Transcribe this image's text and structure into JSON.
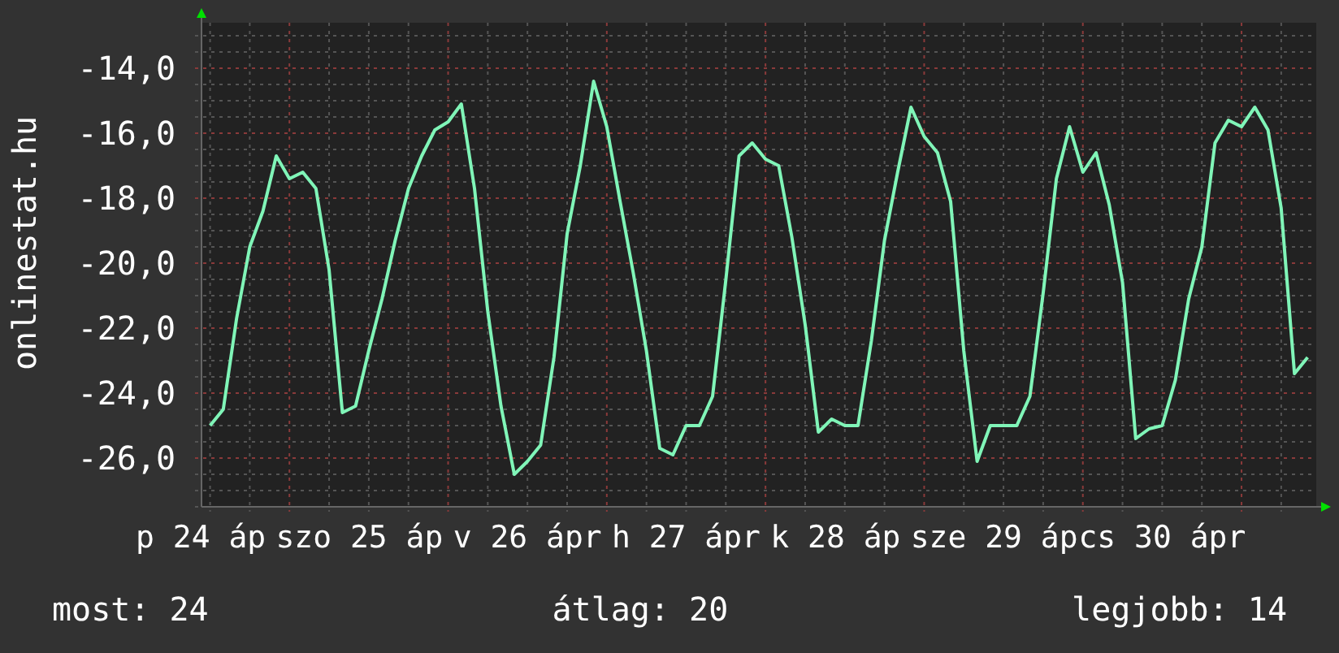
{
  "chart": {
    "chart_data": {
      "type": "line",
      "grid": true,
      "ylabel": "onlinestat.hu",
      "ylim": [
        -27.5,
        -12.6
      ],
      "yticks": [
        {
          "value": -14,
          "label": "-14,0"
        },
        {
          "value": -16,
          "label": "-16,0"
        },
        {
          "value": -18,
          "label": "-18,0"
        },
        {
          "value": -20,
          "label": "-20,0"
        },
        {
          "value": -22,
          "label": "-22,0"
        },
        {
          "value": -24,
          "label": "-24,0"
        },
        {
          "value": -26,
          "label": "-26,0"
        }
      ],
      "categories": [
        "p 24 áp",
        null,
        null,
        null,
        null,
        null,
        null,
        null,
        null,
        null,
        null,
        null,
        "szo 25 áp",
        null,
        null,
        null,
        null,
        null,
        null,
        null,
        null,
        null,
        null,
        null,
        "v 26 ápr",
        null,
        null,
        null,
        null,
        null,
        null,
        null,
        null,
        null,
        null,
        null,
        "h 27 ápr",
        null,
        null,
        null,
        null,
        null,
        null,
        null,
        null,
        null,
        null,
        null,
        "k 28 áp",
        null,
        null,
        null,
        null,
        null,
        null,
        null,
        null,
        null,
        null,
        null,
        "sze 29 áp",
        null,
        null,
        null,
        null,
        null,
        null,
        null,
        null,
        null,
        null,
        null,
        "cs 30 ápr",
        null,
        null,
        null,
        null,
        null,
        null,
        null,
        null,
        null,
        null,
        null
      ],
      "series": [
        {
          "color": "#80f5b8",
          "values": [
            -25,
            -24.5,
            -21.7,
            -19.5,
            -18.4,
            -16.7,
            -17.4,
            -17.2,
            -17.7,
            -20.2,
            -24.6,
            -24.4,
            -22.7,
            -21.1,
            -19.3,
            -17.7,
            -16.7,
            -15.9,
            -15.65,
            -15.1,
            -17.7,
            -21.5,
            -24.4,
            -26.5,
            -26.1,
            -25.6,
            -22.9,
            -19.1,
            -17,
            -14.4,
            -15.8,
            -18.1,
            -20.3,
            -22.7,
            -25.7,
            -25.9,
            -25,
            -25,
            -24.1,
            -20.5,
            -16.7,
            -16.3,
            -16.8,
            -17,
            -19.2,
            -21.9,
            -25.2,
            -24.8,
            -25,
            -25,
            -22.4,
            -19.3,
            -17.2,
            -15.2,
            -16.1,
            -16.6,
            -18.1,
            -22.7,
            -26.1,
            -25,
            -25,
            -25,
            -24.1,
            -20.9,
            -17.4,
            -15.8,
            -17.2,
            -16.6,
            -18.2,
            -20.6,
            -25.4,
            -25.1,
            -25,
            -23.6,
            -21.1,
            -19.5,
            -16.3,
            -15.6,
            -15.8,
            -15.2,
            -15.9,
            -18.3,
            -23.4,
            -22.9
          ]
        }
      ]
    }
  },
  "legend": [
    "most: 24",
    "átlag: 20",
    "legjobb: 14"
  ]
}
